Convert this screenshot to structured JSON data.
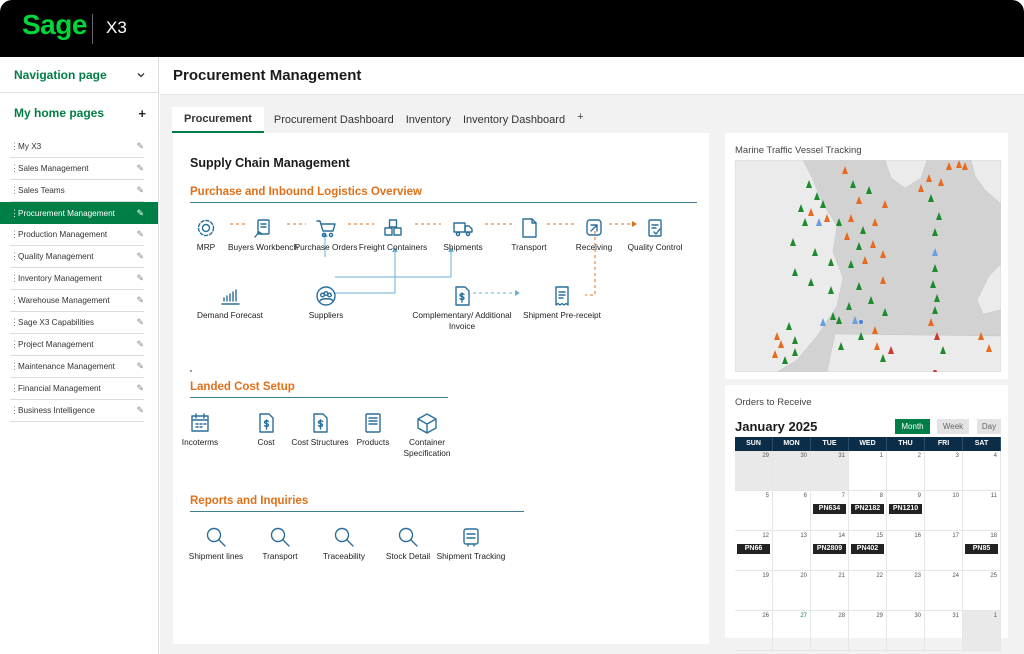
{
  "header": {
    "brand": "Sage",
    "product": "X3"
  },
  "sidebar": {
    "nav_label": "Navigation page",
    "home_label": "My home pages",
    "items": [
      {
        "label": "My X3"
      },
      {
        "label": "Sales Management"
      },
      {
        "label": "Sales Teams"
      },
      {
        "label": "Procurement Management",
        "active": true
      },
      {
        "label": "Production Management"
      },
      {
        "label": "Quality Management"
      },
      {
        "label": "Inventory Management"
      },
      {
        "label": "Warehouse Management"
      },
      {
        "label": "Sage X3 Capabilities"
      },
      {
        "label": "Project Management"
      },
      {
        "label": "Maintenance Management"
      },
      {
        "label": "Financial Management"
      },
      {
        "label": "Business Intelligence"
      }
    ]
  },
  "page": {
    "title": "Procurement Management"
  },
  "tabs": [
    {
      "label": "Procurement",
      "active": true
    },
    {
      "label": "Procurement Dashboard"
    },
    {
      "label": "Inventory"
    },
    {
      "label": "Inventory Dashboard"
    },
    {
      "label": "+"
    }
  ],
  "main": {
    "title": "Supply Chain Management",
    "section1": {
      "title": "Purchase and Inbound Logistics Overview",
      "steps": [
        {
          "id": "mrp",
          "label": "MRP",
          "icon": "gear-icon"
        },
        {
          "id": "buyers",
          "label": "Buyers Workbench",
          "icon": "clipboard-hand-icon"
        },
        {
          "id": "po",
          "label": "Purchase Orders",
          "icon": "cart-icon"
        },
        {
          "id": "fc",
          "label": "Freight Containers",
          "icon": "boxes-icon"
        },
        {
          "id": "ship",
          "label": "Shipments",
          "icon": "truck-icon"
        },
        {
          "id": "transport",
          "label": "Transport",
          "icon": "document-icon"
        },
        {
          "id": "receiving",
          "label": "Receiving",
          "icon": "receive-icon"
        },
        {
          "id": "qc",
          "label": "Quality Control",
          "icon": "checklist-icon"
        },
        {
          "id": "df",
          "label": "Demand Forecast",
          "icon": "chart-icon"
        },
        {
          "id": "sup",
          "label": "Suppliers",
          "icon": "people-icon"
        },
        {
          "id": "inv",
          "label": "Complementary/ Additional Invoice",
          "icon": "invoice-icon"
        },
        {
          "id": "pre",
          "label": "Shipment Pre-receipt",
          "icon": "receipt-icon"
        }
      ]
    },
    "section2": {
      "title": "Landed Cost Setup",
      "items": [
        {
          "label": "Incoterms",
          "icon": "calendar-icon"
        },
        {
          "label": "Cost",
          "icon": "dollar-doc-icon"
        },
        {
          "label": "Cost Structures",
          "icon": "dollar-doc-icon"
        },
        {
          "label": "Products",
          "icon": "book-icon"
        },
        {
          "label": "Container Specification",
          "icon": "box-icon"
        }
      ]
    },
    "section3": {
      "title": "Reports and Inquiries",
      "items": [
        {
          "label": "Shipment lines",
          "icon": "search-icon"
        },
        {
          "label": "Transport",
          "icon": "search-icon"
        },
        {
          "label": "Traceability",
          "icon": "search-icon"
        },
        {
          "label": "Stock Detail",
          "icon": "search-icon"
        },
        {
          "label": "Shipment Tracking",
          "icon": "tracking-icon"
        }
      ]
    }
  },
  "marine": {
    "title": "Marine Traffic Vessel Tracking"
  },
  "orders": {
    "title": "Orders to Receive",
    "month": "January 2025",
    "views": [
      {
        "label": "Month",
        "active": true
      },
      {
        "label": "Week"
      },
      {
        "label": "Day"
      }
    ],
    "weekdays": [
      "SUN",
      "MON",
      "TUE",
      "WED",
      "THU",
      "FRI",
      "SAT"
    ],
    "weeks": [
      [
        {
          "d": "29",
          "gray": true
        },
        {
          "d": "30",
          "gray": true
        },
        {
          "d": "31",
          "gray": true
        },
        {
          "d": "1"
        },
        {
          "d": "2"
        },
        {
          "d": "3"
        },
        {
          "d": "4"
        }
      ],
      [
        {
          "d": "5"
        },
        {
          "d": "6"
        },
        {
          "d": "7",
          "ev": "PN634"
        },
        {
          "d": "8",
          "ev": "PN2182"
        },
        {
          "d": "9",
          "ev": "PN1210"
        },
        {
          "d": "10"
        },
        {
          "d": "11"
        }
      ],
      [
        {
          "d": "12",
          "ev": "PN66"
        },
        {
          "d": "13"
        },
        {
          "d": "14",
          "ev": "PN2809"
        },
        {
          "d": "15",
          "ev": "PN402"
        },
        {
          "d": "16"
        },
        {
          "d": "17"
        },
        {
          "d": "18",
          "ev": "PN85"
        }
      ],
      [
        {
          "d": "19"
        },
        {
          "d": "20"
        },
        {
          "d": "21"
        },
        {
          "d": "22"
        },
        {
          "d": "23"
        },
        {
          "d": "24"
        },
        {
          "d": "25"
        }
      ],
      [
        {
          "d": "26"
        },
        {
          "d": "27",
          "green": true
        },
        {
          "d": "28"
        },
        {
          "d": "29"
        },
        {
          "d": "30"
        },
        {
          "d": "31"
        },
        {
          "d": "1",
          "gray": true
        }
      ]
    ]
  },
  "colors": {
    "brand": "#00d639",
    "accent": "#007e45",
    "section": "#e0701a",
    "calendar_head": "#0c2d48"
  }
}
